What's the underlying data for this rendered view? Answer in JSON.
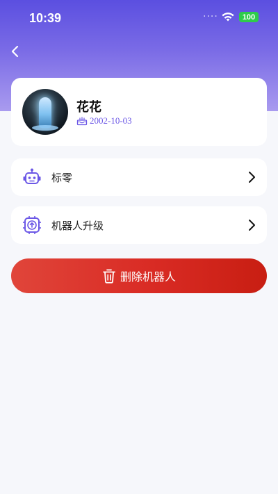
{
  "status_bar": {
    "time": "10:39",
    "battery": "100"
  },
  "profile": {
    "name": "花花",
    "birthday": "2002-10-03"
  },
  "menu": [
    {
      "label": "标零"
    },
    {
      "label": "机器人升级"
    }
  ],
  "delete_button": {
    "label": "删除机器人"
  },
  "colors": {
    "header_gradient_top": "#5b4fe0",
    "accent": "#6b57e6",
    "danger": "#d92b24",
    "battery": "#2ecc4a"
  },
  "icons": {
    "back": "chevron-left-icon",
    "birthday": "cake-icon",
    "menu_0": "robot-icon",
    "menu_1": "upgrade-chip-icon",
    "delete": "trash-icon"
  }
}
